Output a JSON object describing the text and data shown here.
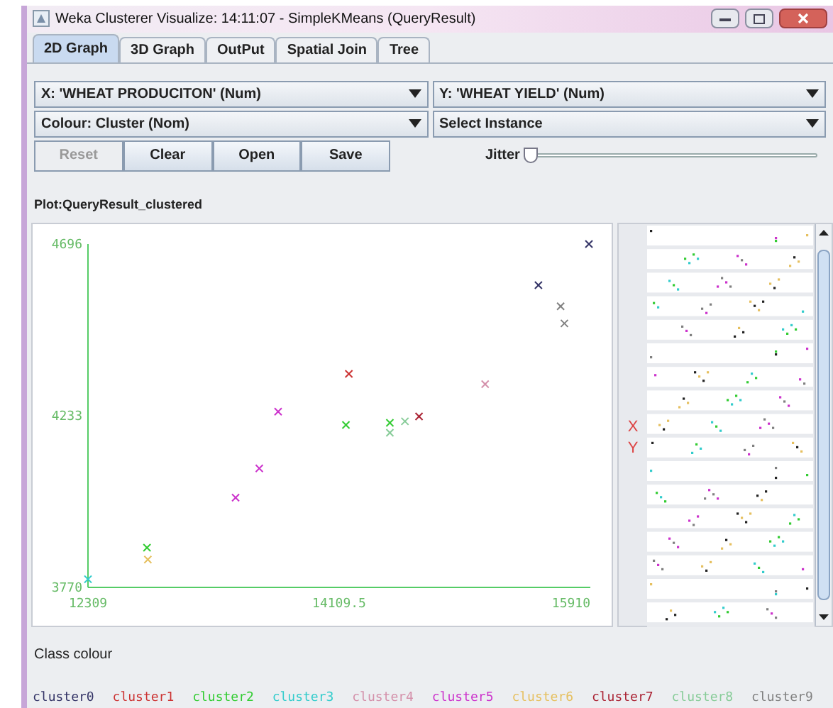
{
  "window": {
    "title": "Weka Clusterer Visualize: 14:11:07 - SimpleKMeans (QueryResult)"
  },
  "tabs": [
    {
      "label": "2D Graph",
      "selected": true
    },
    {
      "label": "3D Graph",
      "selected": false
    },
    {
      "label": "OutPut",
      "selected": false
    },
    {
      "label": "Spatial Join",
      "selected": false
    },
    {
      "label": "Tree",
      "selected": false
    }
  ],
  "selects": [
    {
      "value": "X: 'WHEAT PRODUCITON' (Num)"
    },
    {
      "value": "Y: 'WHEAT YIELD' (Num)"
    },
    {
      "value": "Colour: Cluster (Nom)"
    },
    {
      "value": "Select Instance"
    }
  ],
  "buttons": [
    {
      "label": "Reset",
      "disabled": true
    },
    {
      "label": "Clear",
      "disabled": false
    },
    {
      "label": "Open",
      "disabled": false
    },
    {
      "label": "Save",
      "disabled": false
    }
  ],
  "jitter": {
    "label": "Jitter",
    "level": 0
  },
  "plot": {
    "title": "Plot:QueryResult_clustered",
    "chart_data": {
      "type": "scatter",
      "xlim": [
        12309,
        15910
      ],
      "ylim": [
        3770,
        4696
      ],
      "xticks": [
        {
          "value": 12309,
          "label": "12309"
        },
        {
          "value": 14109.5,
          "label": "14109.5"
        },
        {
          "value": 15910,
          "label": "15910"
        }
      ],
      "yticks": [
        {
          "value": 3770,
          "label": "3770"
        },
        {
          "value": 4233,
          "label": "4233"
        },
        {
          "value": 4696,
          "label": "4696"
        }
      ],
      "series": [
        {
          "name": "cluster0",
          "color": "#333366",
          "x": [
            15900,
            15538
          ],
          "values": [
            4696,
            4585
          ]
        },
        {
          "name": "cluster1",
          "color": "#cc3333",
          "x": [
            14179
          ],
          "values": [
            4346
          ]
        },
        {
          "name": "cluster2",
          "color": "#33cc33",
          "x": [
            14158,
            14473,
            12732
          ],
          "values": [
            4208,
            4214,
            3877
          ]
        },
        {
          "name": "cluster3",
          "color": "#33cccc",
          "x": [
            12309
          ],
          "values": [
            3792
          ]
        },
        {
          "name": "cluster4",
          "color": "#d490aa",
          "x": [
            15156
          ],
          "values": [
            4318
          ]
        },
        {
          "name": "cluster5",
          "color": "#cc33cc",
          "x": [
            13672,
            13537,
            13367
          ],
          "values": [
            4244,
            4091,
            4012
          ]
        },
        {
          "name": "cluster6",
          "color": "#e6c060",
          "x": [
            12738
          ],
          "values": [
            3845
          ]
        },
        {
          "name": "cluster7",
          "color": "#aa2233",
          "x": [
            14682
          ],
          "values": [
            4231
          ]
        },
        {
          "name": "cluster8",
          "color": "#88cc99",
          "x": [
            14473,
            14581
          ],
          "values": [
            4187,
            4218
          ]
        },
        {
          "name": "cluster9",
          "color": "#808080",
          "x": [
            15697,
            15724
          ],
          "values": [
            4528,
            4482
          ]
        }
      ]
    }
  },
  "attribute_panel": {
    "x_label": "X",
    "y_label": "Y"
  },
  "class_colour": {
    "title": "Class colour"
  }
}
